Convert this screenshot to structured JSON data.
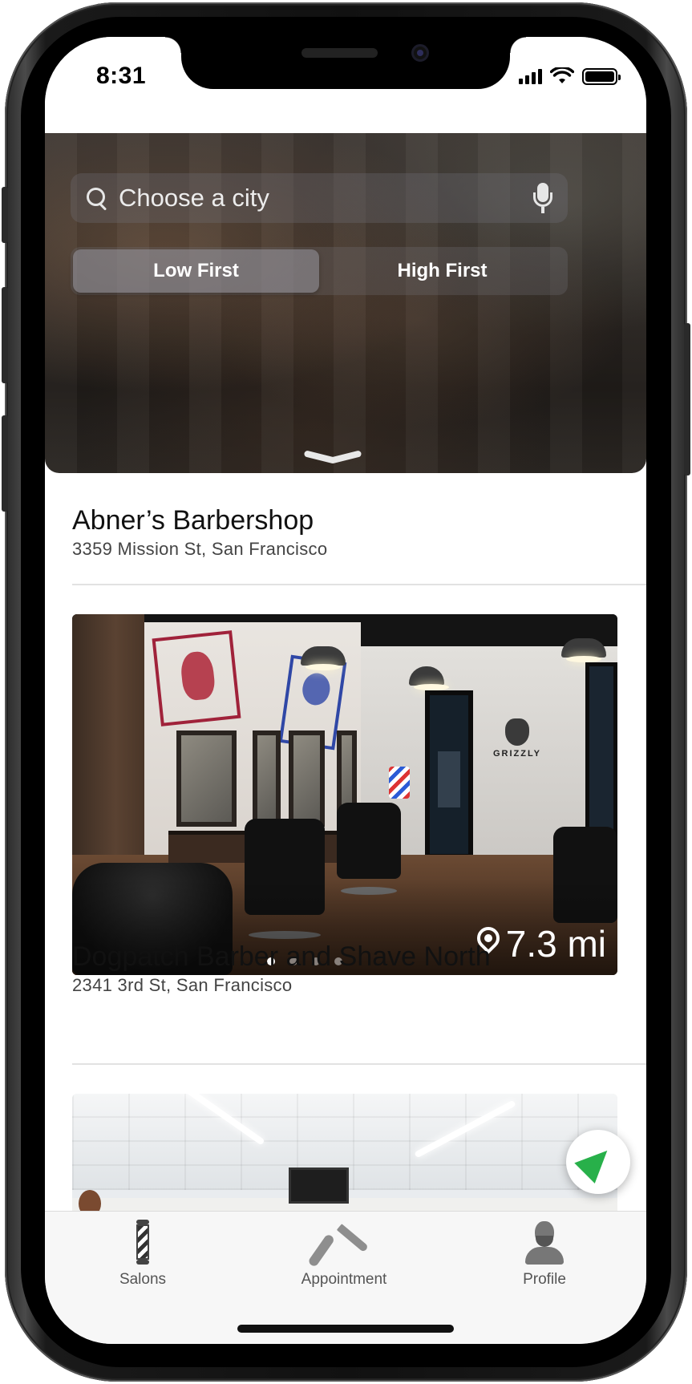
{
  "status_bar": {
    "time": "8:31",
    "icons": [
      "signal-icon",
      "wifi-icon",
      "battery-icon"
    ]
  },
  "header": {
    "search": {
      "placeholder": "Choose a city",
      "value": "",
      "left_icon": "search-icon",
      "right_icon": "mic-icon"
    },
    "sort": {
      "options": [
        "Low First",
        "High First"
      ],
      "selected": "Low First"
    },
    "collapse_icon": "chevron-down-icon"
  },
  "salons": [
    {
      "name": "Abner’s Barbershop",
      "address": "3359 Mission St, San Francisco"
    },
    {
      "name": "Dogpatch Barber and Shave North",
      "address": "2341 3rd St, San Francisco",
      "distance": "7.3 mi",
      "photo_brand": "GRIZZLY",
      "photo_count": 4,
      "photo_current": 1
    },
    {
      "name": "",
      "address": ""
    }
  ],
  "locate_button": {
    "icon": "location-arrow-icon",
    "color": "#28b04a"
  },
  "tab_bar": {
    "tabs": [
      {
        "label": "Salons",
        "icon": "barber-pole-icon"
      },
      {
        "label": "Appointment",
        "icon": "razor-icon"
      },
      {
        "label": "Profile",
        "icon": "barber-avatar-icon"
      }
    ]
  }
}
